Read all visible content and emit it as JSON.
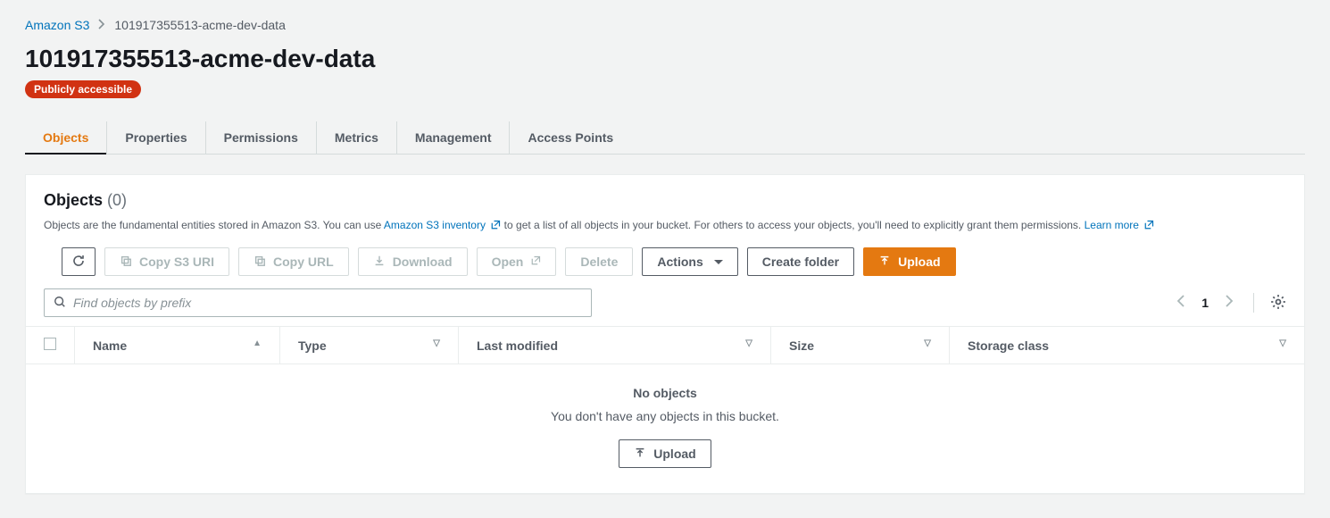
{
  "breadcrumb": {
    "root": "Amazon S3",
    "current": "101917355513-acme-dev-data"
  },
  "header": {
    "title": "101917355513-acme-dev-data",
    "badge": "Publicly accessible"
  },
  "tabs": [
    {
      "label": "Objects",
      "active": true
    },
    {
      "label": "Properties",
      "active": false
    },
    {
      "label": "Permissions",
      "active": false
    },
    {
      "label": "Metrics",
      "active": false
    },
    {
      "label": "Management",
      "active": false
    },
    {
      "label": "Access Points",
      "active": false
    }
  ],
  "objectsPanel": {
    "title": "Objects",
    "count": "(0)",
    "desc_prefix": "Objects are the fundamental entities stored in Amazon S3. You can use ",
    "desc_link1": "Amazon S3 inventory",
    "desc_mid": " to get a list of all objects in your bucket. For others to access your objects, you'll need to explicitly grant them permissions. ",
    "desc_link2": "Learn more"
  },
  "toolbar": {
    "refresh_label": "Refresh",
    "copy_s3_uri": "Copy S3 URI",
    "copy_url": "Copy URL",
    "download": "Download",
    "open": "Open",
    "delete": "Delete",
    "actions": "Actions",
    "create_folder": "Create folder",
    "upload": "Upload"
  },
  "search": {
    "placeholder": "Find objects by prefix"
  },
  "pager": {
    "page": "1"
  },
  "table": {
    "columns": [
      "Name",
      "Type",
      "Last modified",
      "Size",
      "Storage class"
    ]
  },
  "empty": {
    "title": "No objects",
    "subtitle": "You don't have any objects in this bucket.",
    "upload": "Upload"
  }
}
